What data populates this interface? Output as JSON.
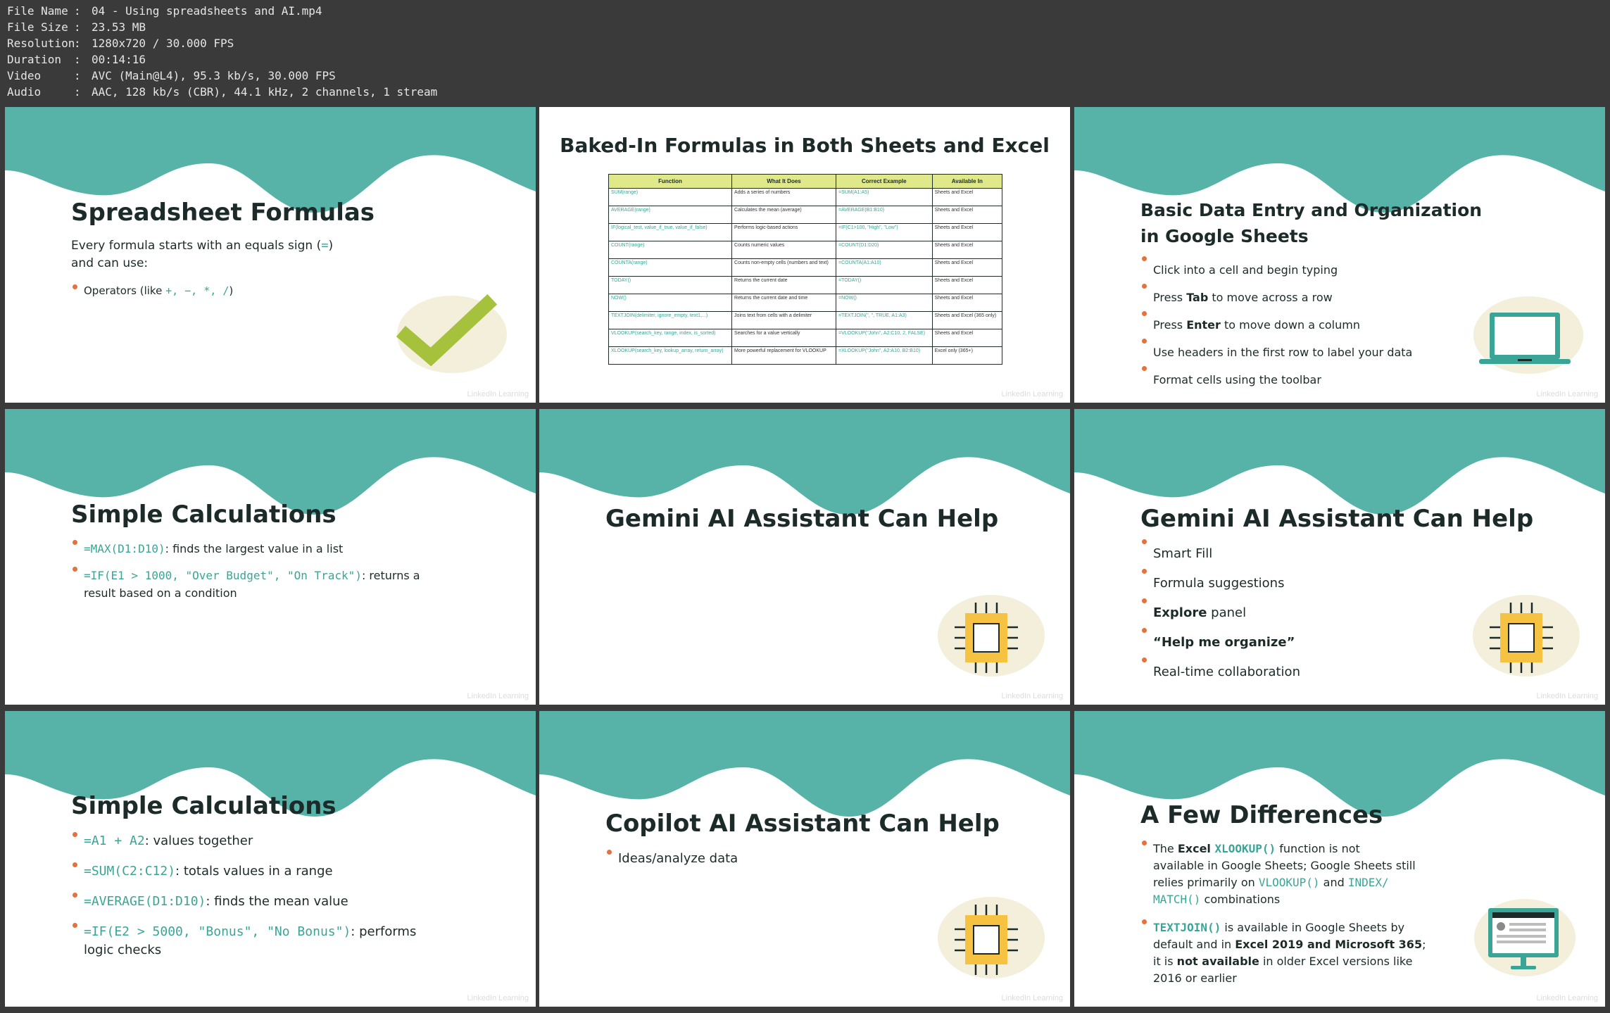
{
  "file_info": [
    {
      "key": "File Name",
      "value": "04 - Using spreadsheets and AI.mp4"
    },
    {
      "key": "File Size",
      "value": "23.53 MB"
    },
    {
      "key": "Resolution",
      "value": "1280x720 / 30.000 FPS"
    },
    {
      "key": "Duration",
      "value": "00:14:16"
    },
    {
      "key": "Video",
      "value": "AVC (Main@L4), 95.3 kb/s, 30.000 FPS"
    },
    {
      "key": "Audio",
      "value": "AAC, 128 kb/s (CBR), 44.1 kHz, 2 channels, 1 stream"
    }
  ],
  "colors": {
    "teal": "#57b3a7",
    "accent": "#e0733e",
    "code": "#3aa596",
    "text": "#1c2b2a",
    "table_header": "#dfe98a"
  },
  "watermark": "LinkedIn Learning",
  "slide1": {
    "title": "Spreadsheet Formulas",
    "intro_a": "Every formula starts with an equals sign (",
    "intro_eq": "=",
    "intro_b": ")",
    "intro_c": "and can use:",
    "bullet_a": "Operators (like ",
    "bullet_ops": "+, −, *, /",
    "bullet_b": ")",
    "icon": "checkmark-icon"
  },
  "slide2": {
    "title": "Baked-In Formulas in Both Sheets and Excel",
    "headers": [
      "Function",
      "What It Does",
      "Correct Example",
      "Available In"
    ],
    "rows": [
      [
        "SUM(range)",
        "Adds a series of numbers",
        "=SUM(A1:A5)",
        "Sheets and Excel"
      ],
      [
        "AVERAGE(range)",
        "Calculates the mean (average)",
        "=AVERAGE(B1:B10)",
        "Sheets and Excel"
      ],
      [
        "IF(logical_test, value_if_true, value_if_false)",
        "Performs logic-based actions",
        "=IF(C1>100, \"High\", \"Low\")",
        "Sheets and Excel"
      ],
      [
        "COUNT(range)",
        "Counts numeric values",
        "=COUNT(D1:D20)",
        "Sheets and Excel"
      ],
      [
        "COUNTA(range)",
        "Counts non-empty cells (numbers and text)",
        "=COUNTA(A1:A10)",
        "Sheets and Excel"
      ],
      [
        "TODAY()",
        "Returns the current date",
        "=TODAY()",
        "Sheets and Excel"
      ],
      [
        "NOW()",
        "Returns the current date and time",
        "=NOW()",
        "Sheets and Excel"
      ],
      [
        "TEXTJOIN(delimiter, ignore_empty, text1,...)",
        "Joins text from cells with a delimiter",
        "=TEXTJOIN(\", \", TRUE, A1:A3)",
        "Sheets and Excel (365 only)"
      ],
      [
        "VLOOKUP(search_key, range, index, is_sorted)",
        "Searches for a value vertically",
        "=VLOOKUP(\"John\", A2:C10, 2, FALSE)",
        "Sheets and Excel"
      ],
      [
        "XLOOKUP(search_key, lookup_array, return_array)",
        "More powerful replacement for VLOOKUP",
        "=XLOOKUP(\"John\", A2:A10, B2:B10)",
        "Excel only (365+)"
      ]
    ]
  },
  "slide3": {
    "title_line1": "Basic Data Entry and Organization",
    "title_line2": "in Google Sheets",
    "b1": "Click into a cell and begin typing",
    "b2_a": "Press ",
    "b2_bold": "Tab",
    "b2_b": " to move across a row",
    "b3_a": "Press ",
    "b3_bold": "Enter",
    "b3_b": " to move down a column",
    "b4": "Use headers in the first row to label your data",
    "b5": "Format cells using the toolbar",
    "icon": "laptop-icon"
  },
  "slide4": {
    "title": "Simple Calculations",
    "b1_code": "=MAX(D1:D10)",
    "b1_text": ": finds the largest value in a list",
    "b2_code": "=IF(E1 > 1000, \"Over Budget\", \"On Track\")",
    "b2_text": ": returns a",
    "b2_text2": "result based on a condition"
  },
  "slide5": {
    "title": "Gemini AI Assistant Can Help",
    "icon": "chip-icon"
  },
  "slide6": {
    "title": "Gemini AI Assistant Can Help",
    "items": [
      "Smart Fill",
      "Formula suggestions",
      "Explore",
      "panel",
      "“Help me organize”",
      "Real-time collaboration"
    ],
    "icon": "chip-icon"
  },
  "slide7": {
    "title": "Simple Calculations",
    "b1_code": "=A1 + A2",
    "b1_text": ": values together",
    "b2_code": "=SUM(C2:C12)",
    "b2_text": ": totals values in a range",
    "b3_code": "=AVERAGE(D1:D10)",
    "b3_text": ": finds the mean value",
    "b4_code": "=IF(E2 > 5000, \"Bonus\", \"No Bonus\")",
    "b4_text": ": performs",
    "b4_text2": "logic checks"
  },
  "slide8": {
    "title": "Copilot AI Assistant Can Help",
    "b1": "Ideas/analyze data",
    "icon": "chip-icon"
  },
  "slide9": {
    "title": "A Few Differences",
    "p1_a": "The ",
    "p1_excel": "Excel ",
    "p1_code": "XLOOKUP()",
    "p1_b": " function is not",
    "p1_l2": "available in Google Sheets; Google Sheets still",
    "p1_l3a": "relies primarily on ",
    "p1_code2": "VLOOKUP()",
    "p1_l3b": " and ",
    "p1_code3": "INDEX/",
    "p1_code4": "MATCH()",
    "p1_l4": " combinations",
    "p2_code": "TEXTJOIN()",
    "p2_a": " is available in Google Sheets by",
    "p2_l2a": "default and in ",
    "p2_l2bold": "Excel 2019 and Microsoft 365",
    "p2_l2b": ";",
    "p2_l3a": "it is ",
    "p2_l3bold": "not available",
    "p2_l3b": " in older Excel versions like",
    "p2_l4": "2016 or earlier",
    "icon": "monitor-icon"
  }
}
